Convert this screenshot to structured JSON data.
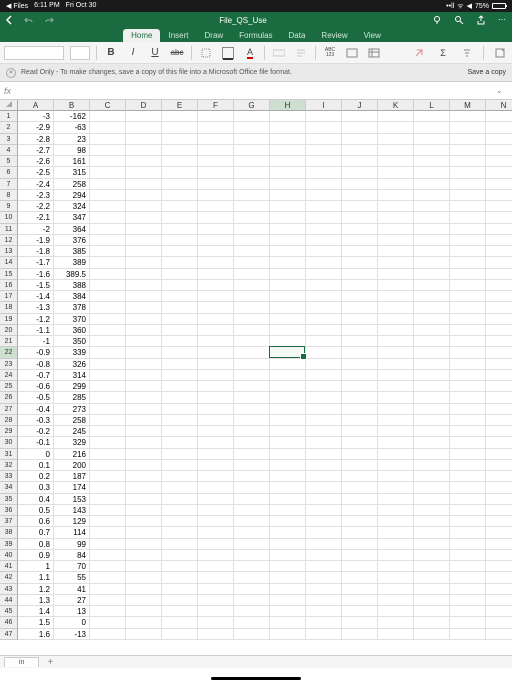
{
  "status": {
    "return_app": "◀ Files",
    "time": "6:11 PM",
    "date": "Fri Oct 30",
    "battery": "75%"
  },
  "title": "File_QS_Use",
  "tabs": [
    "Home",
    "Insert",
    "Draw",
    "Formulas",
    "Data",
    "Review",
    "View"
  ],
  "active_tab": "Home",
  "toolbar": {
    "abc": "abc",
    "abc123": "ABC\n123"
  },
  "readonly": {
    "text": "Read Only - To make changes, save a copy of this file into a Microsoft Office file format.",
    "save": "Save a copy"
  },
  "columns": [
    "A",
    "B",
    "C",
    "D",
    "E",
    "F",
    "G",
    "H",
    "I",
    "J",
    "K",
    "L",
    "M",
    "N"
  ],
  "selected_col": "H",
  "selected_row": 22,
  "selection_cell": "H22",
  "rows": [
    {
      "n": 1,
      "a": "-3",
      "b": "-162"
    },
    {
      "n": 2,
      "a": "-2.9",
      "b": "-63"
    },
    {
      "n": 3,
      "a": "-2.8",
      "b": "23"
    },
    {
      "n": 4,
      "a": "-2.7",
      "b": "98"
    },
    {
      "n": 5,
      "a": "-2.6",
      "b": "161"
    },
    {
      "n": 6,
      "a": "-2.5",
      "b": "315"
    },
    {
      "n": 7,
      "a": "-2.4",
      "b": "258"
    },
    {
      "n": 8,
      "a": "-2.3",
      "b": "294"
    },
    {
      "n": 9,
      "a": "-2.2",
      "b": "324"
    },
    {
      "n": 10,
      "a": "-2.1",
      "b": "347"
    },
    {
      "n": 11,
      "a": "-2",
      "b": "364"
    },
    {
      "n": 12,
      "a": "-1.9",
      "b": "376"
    },
    {
      "n": 13,
      "a": "-1.8",
      "b": "385"
    },
    {
      "n": 14,
      "a": "-1.7",
      "b": "389"
    },
    {
      "n": 15,
      "a": "-1.6",
      "b": "389.5"
    },
    {
      "n": 16,
      "a": "-1.5",
      "b": "388"
    },
    {
      "n": 17,
      "a": "-1.4",
      "b": "384"
    },
    {
      "n": 18,
      "a": "-1.3",
      "b": "378"
    },
    {
      "n": 19,
      "a": "-1.2",
      "b": "370"
    },
    {
      "n": 20,
      "a": "-1.1",
      "b": "360"
    },
    {
      "n": 21,
      "a": "-1",
      "b": "350"
    },
    {
      "n": 22,
      "a": "-0.9",
      "b": "339"
    },
    {
      "n": 23,
      "a": "-0.8",
      "b": "326"
    },
    {
      "n": 24,
      "a": "-0.7",
      "b": "314"
    },
    {
      "n": 25,
      "a": "-0.6",
      "b": "299"
    },
    {
      "n": 26,
      "a": "-0.5",
      "b": "285"
    },
    {
      "n": 27,
      "a": "-0.4",
      "b": "273"
    },
    {
      "n": 28,
      "a": "-0.3",
      "b": "258"
    },
    {
      "n": 29,
      "a": "-0.2",
      "b": "245"
    },
    {
      "n": 30,
      "a": "-0.1",
      "b": "329"
    },
    {
      "n": 31,
      "a": "0",
      "b": "216"
    },
    {
      "n": 32,
      "a": "0.1",
      "b": "200"
    },
    {
      "n": 33,
      "a": "0.2",
      "b": "187"
    },
    {
      "n": 34,
      "a": "0.3",
      "b": "174"
    },
    {
      "n": 35,
      "a": "0.4",
      "b": "153"
    },
    {
      "n": 36,
      "a": "0.5",
      "b": "143"
    },
    {
      "n": 37,
      "a": "0.6",
      "b": "129"
    },
    {
      "n": 38,
      "a": "0.7",
      "b": "114"
    },
    {
      "n": 39,
      "a": "0.8",
      "b": "99"
    },
    {
      "n": 40,
      "a": "0.9",
      "b": "84"
    },
    {
      "n": 41,
      "a": "1",
      "b": "70"
    },
    {
      "n": 42,
      "a": "1.1",
      "b": "55"
    },
    {
      "n": 43,
      "a": "1.2",
      "b": "41"
    },
    {
      "n": 44,
      "a": "1.3",
      "b": "27"
    },
    {
      "n": 45,
      "a": "1.4",
      "b": "13"
    },
    {
      "n": 46,
      "a": "1.5",
      "b": "0"
    },
    {
      "n": 47,
      "a": "1.6",
      "b": "-13"
    }
  ],
  "sheet_name": "in",
  "fx_label": "fx"
}
